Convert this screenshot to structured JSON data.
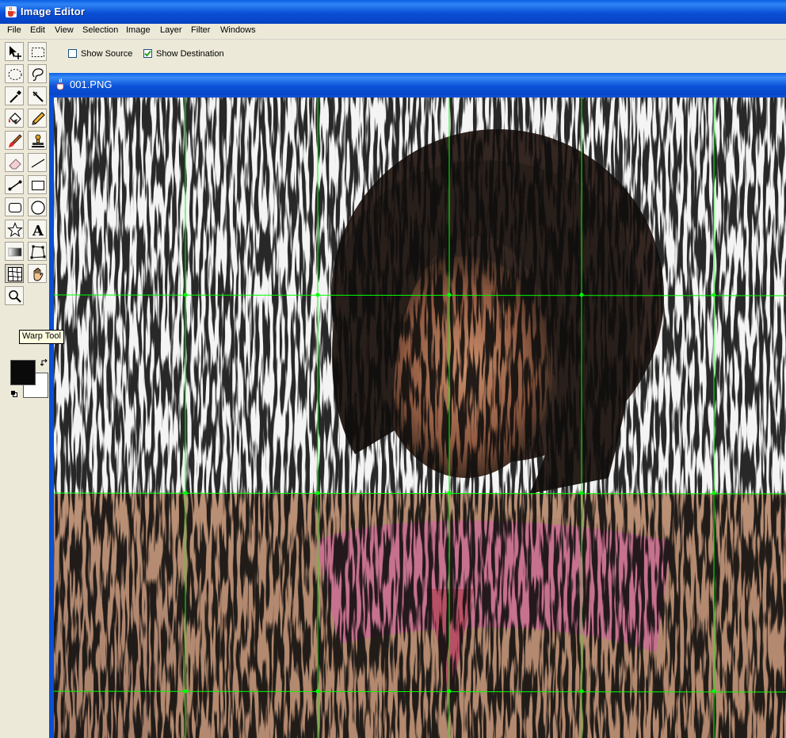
{
  "window": {
    "title": "Image Editor",
    "icon": "java-cup-icon"
  },
  "menu": [
    "File",
    "Edit",
    "View",
    "Selection",
    "Image",
    "Layer",
    "Filter",
    "Windows"
  ],
  "options": {
    "show_source_label": "Show Source",
    "show_source_checked": false,
    "show_destination_label": "Show Destination",
    "show_destination_checked": true
  },
  "toolbox": {
    "tools": [
      "move-tool-icon",
      "rect-select-icon",
      "ellipse-select-icon",
      "lasso-icon",
      "eyedropper-icon",
      "line-measure-icon",
      "paint-bucket-icon",
      "pencil-icon",
      "brush-icon",
      "stamp-icon",
      "eraser-icon",
      "line-icon",
      "connector-icon",
      "rectangle-icon",
      "rounded-rect-icon",
      "ellipse-icon",
      "star-icon",
      "text-icon",
      "gradient-icon",
      "polygon-icon",
      "warp-tool-icon",
      "hand-icon",
      "zoom-icon"
    ],
    "active_tool": "warp-tool-icon",
    "tooltip": "Warp Tool",
    "foreground_color": "#0a0a0a",
    "background_color": "#ffffff"
  },
  "document": {
    "title": "001.PNG",
    "grid_color": "#00ff00"
  }
}
